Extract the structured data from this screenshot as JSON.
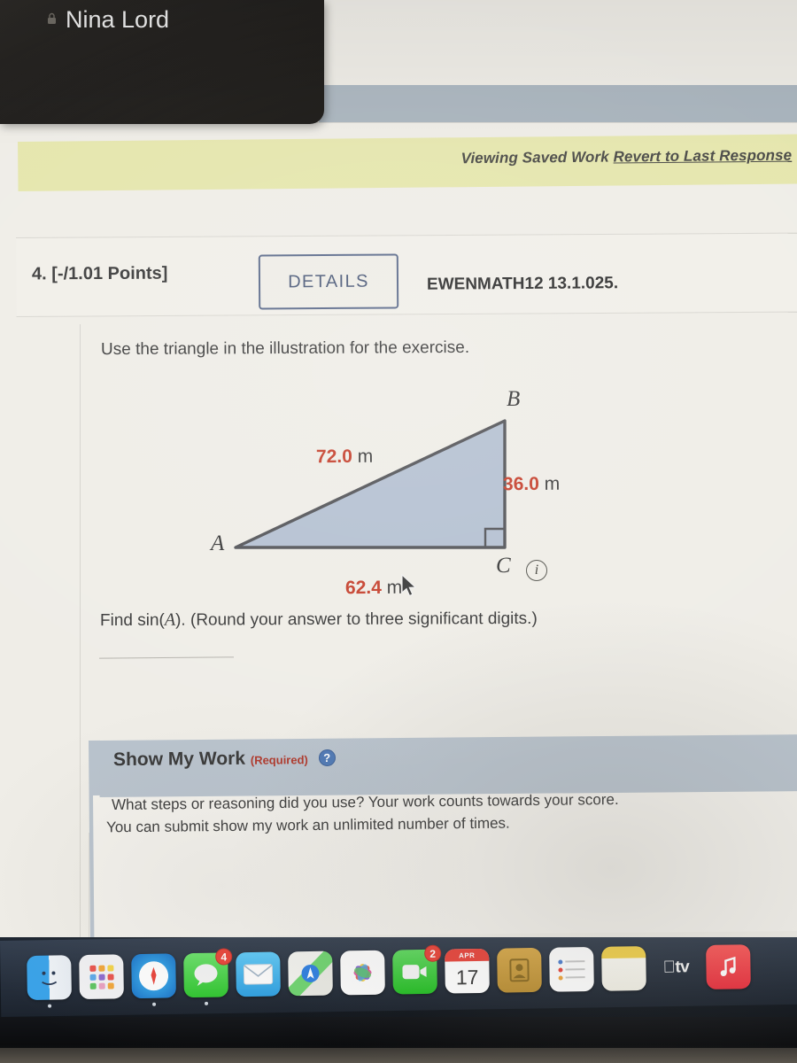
{
  "overlay": {
    "participant_name": "Nina Lord",
    "badge_icon": "lock-icon"
  },
  "banner": {
    "status_text": "Viewing Saved Work",
    "revert_link": "Revert to Last Response"
  },
  "question": {
    "number": "4.",
    "points": "[-/1.01 Points]",
    "details_label": "DETAILS",
    "code": "EWENMATH12 13.1.025.",
    "instruction": "Use the triangle in the illustration for the exercise.",
    "prompt_lead": "Find sin(",
    "prompt_var": "A",
    "prompt_tail": "). (Round your answer to three significant digits.)",
    "info_icon": "i"
  },
  "figure": {
    "type": "right-triangle",
    "vertices": [
      {
        "label": "A",
        "position": "bottom-left"
      },
      {
        "label": "B",
        "position": "top-right"
      },
      {
        "label": "C",
        "position": "bottom-right"
      }
    ],
    "measurements": [
      {
        "side": "AB",
        "value": "72.0",
        "unit": "m"
      },
      {
        "side": "BC",
        "value": "36.0",
        "unit": "m"
      },
      {
        "side": "AC",
        "value": "62.4",
        "unit": "m"
      }
    ],
    "right_angle_at": "C",
    "fill_color": "#b5c1d2",
    "stroke_color": "#55565a",
    "measurement_color": "#c6422f"
  },
  "show_my_work": {
    "title": "Show My Work",
    "required_label": "(Required)",
    "help_icon": "?",
    "line1": "What steps or reasoning did you use? Your work counts towards your score.",
    "line2": "You can submit show my work an unlimited number of times."
  },
  "dock": {
    "items": [
      {
        "name": "finder",
        "label": "Finder",
        "icon": "finder-icon",
        "badge": "",
        "running": true
      },
      {
        "name": "launchpad",
        "label": "Launchpad",
        "icon": "launchpad-icon",
        "badge": "",
        "running": false
      },
      {
        "name": "safari",
        "label": "Safari",
        "icon": "safari-icon",
        "badge": "",
        "running": true
      },
      {
        "name": "messages",
        "label": "Messages",
        "icon": "messages-icon",
        "badge": "4",
        "running": true
      },
      {
        "name": "mail",
        "label": "Mail",
        "icon": "mail-icon",
        "badge": "",
        "running": false
      },
      {
        "name": "maps",
        "label": "Maps",
        "icon": "maps-icon",
        "badge": "",
        "running": false
      },
      {
        "name": "photos",
        "label": "Photos",
        "icon": "photos-icon",
        "badge": "",
        "running": false
      },
      {
        "name": "facetime",
        "label": "FaceTime",
        "icon": "facetime-icon",
        "badge": "2",
        "running": false
      },
      {
        "name": "calendar",
        "label": "Calendar",
        "icon": "calendar-icon",
        "badge": "",
        "running": false,
        "month": "APR",
        "day": "17"
      },
      {
        "name": "contacts",
        "label": "Contacts",
        "icon": "contacts-icon",
        "badge": "",
        "running": false
      },
      {
        "name": "reminders",
        "label": "Reminders",
        "icon": "reminders-icon",
        "badge": "",
        "running": false
      },
      {
        "name": "notes",
        "label": "Notes",
        "icon": "notes-icon",
        "badge": "",
        "running": false
      },
      {
        "name": "appletv",
        "label": "tv",
        "icon": "apple-tv-icon",
        "badge": "",
        "running": false
      },
      {
        "name": "music",
        "label": "Music",
        "icon": "music-icon",
        "badge": "",
        "running": false
      }
    ]
  }
}
